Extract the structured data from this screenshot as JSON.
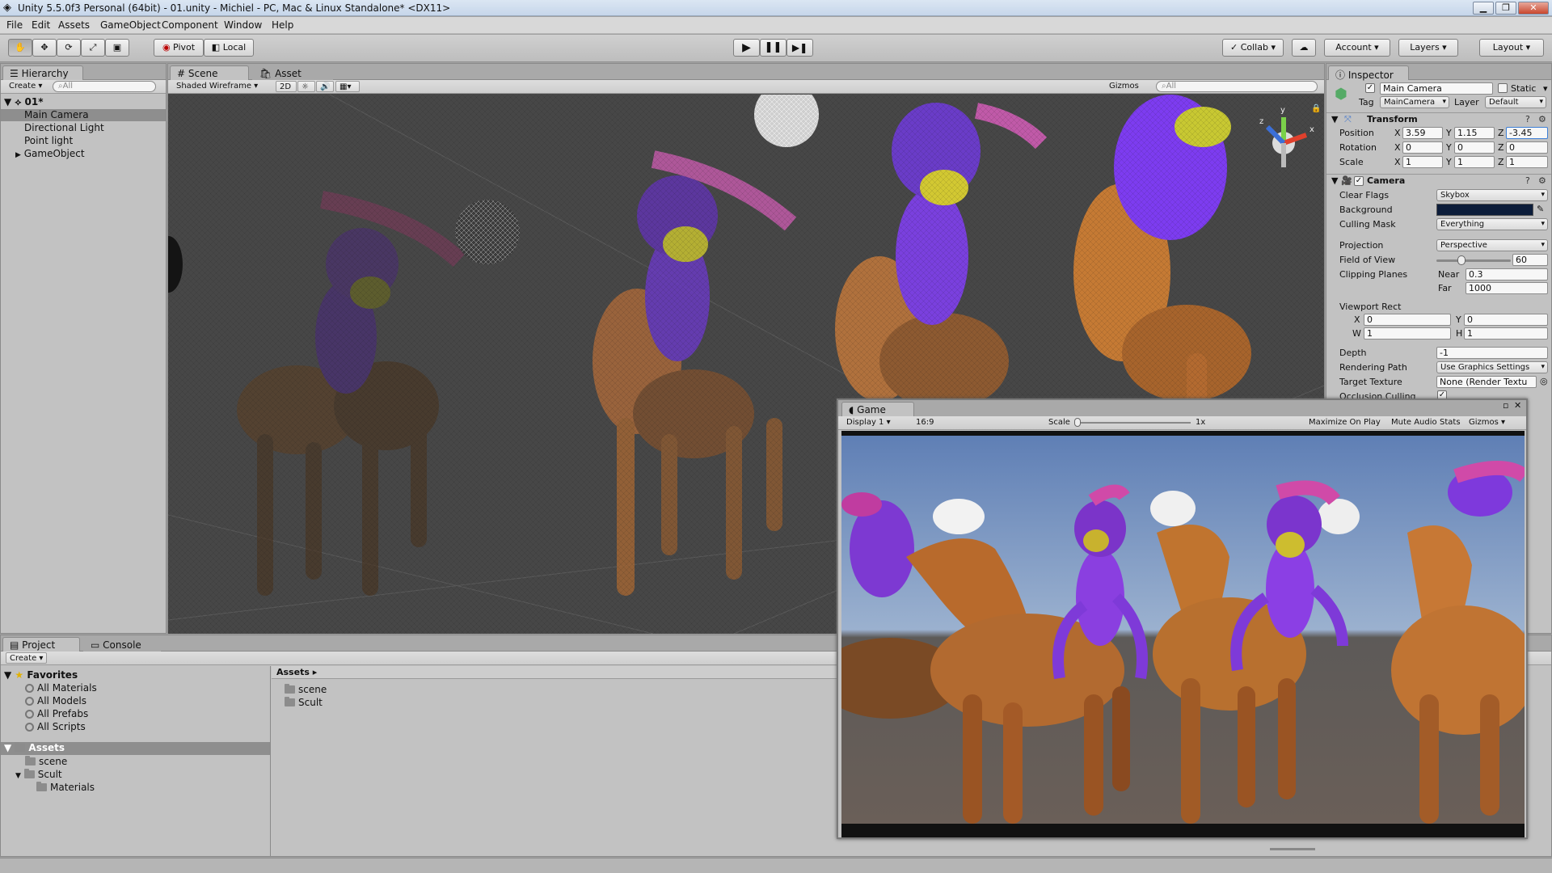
{
  "window": {
    "title": "Unity 5.5.0f3 Personal (64bit) - 01.unity - Michiel - PC, Mac & Linux Standalone* <DX11>",
    "min": "▁",
    "max": "❐",
    "close": "✕"
  },
  "menu": [
    "File",
    "Edit",
    "Assets",
    "GameObject",
    "Component",
    "Window",
    "Help"
  ],
  "toolbar": {
    "pivot": "Pivot",
    "local": "Local",
    "collab": "Collab",
    "account": "Account",
    "layers": "Layers",
    "layout": "Layout"
  },
  "hierarchy": {
    "tab": "Hierarchy",
    "create": "Create",
    "search_placeholder": "All",
    "scene": "01*",
    "items": [
      "Main Camera",
      "Directional Light",
      "Point light",
      "GameObject"
    ]
  },
  "scene_view": {
    "tab_scene": "Scene",
    "tab_store": "Asset Store",
    "shading": "Shaded Wireframe",
    "mode2d": "2D",
    "gizmos": "Gizmos",
    "search_placeholder": "All",
    "axes": {
      "y": "y",
      "x": "x",
      "z": "z"
    }
  },
  "game_view": {
    "tab": "Game",
    "display": "Display 1",
    "aspect": "16:9",
    "scale_label": "Scale",
    "scale_value": "1x",
    "maximize": "Maximize On Play",
    "mute": "Mute Audio",
    "stats": "Stats",
    "gizmos": "Gizmos"
  },
  "inspector": {
    "tab": "Inspector",
    "object_name": "Main Camera",
    "static_label": "Static",
    "tag_label": "Tag",
    "tag_value": "MainCamera",
    "layer_label": "Layer",
    "layer_value": "Default",
    "transform": {
      "title": "Transform",
      "position_label": "Position",
      "pos": {
        "x": "3.59",
        "y": "1.15",
        "z": "-3.45"
      },
      "rotation_label": "Rotation",
      "rot": {
        "x": "0",
        "y": "0",
        "z": "0"
      },
      "scale_label": "Scale",
      "scl": {
        "x": "1",
        "y": "1",
        "z": "1"
      },
      "xl": "X",
      "yl": "Y",
      "zl": "Z"
    },
    "camera": {
      "title": "Camera",
      "clear_flags_label": "Clear Flags",
      "clear_flags": "Skybox",
      "background_label": "Background",
      "background_color": "#0c1d3a",
      "culling_label": "Culling Mask",
      "culling": "Everything",
      "projection_label": "Projection",
      "projection": "Perspective",
      "fov_label": "Field of View",
      "fov": "60",
      "fov_level": 0.33,
      "clipping_label": "Clipping Planes",
      "near_label": "Near",
      "near": "0.3",
      "far_label": "Far",
      "far": "1000",
      "viewport_label": "Viewport Rect",
      "vp_x": "0",
      "vp_y": "0",
      "vp_w": "1",
      "vp_h": "1",
      "wl": "W",
      "hl": "H",
      "depth_label": "Depth",
      "depth": "-1",
      "rendering_label": "Rendering Path",
      "rendering": "Use Graphics Settings",
      "target_label": "Target Texture",
      "target": "None (Render Textu",
      "occlusion_label": "Occlusion Culling"
    }
  },
  "project": {
    "tab_project": "Project",
    "tab_console": "Console",
    "create": "Create",
    "favorites_label": "Favorites",
    "favorites": [
      "All Materials",
      "All Models",
      "All Prefabs",
      "All Scripts"
    ],
    "assets_label": "Assets",
    "tree": [
      "scene",
      "Scult",
      "Materials"
    ],
    "breadcrumb": "Assets",
    "files": [
      "scene",
      "Scult"
    ]
  }
}
